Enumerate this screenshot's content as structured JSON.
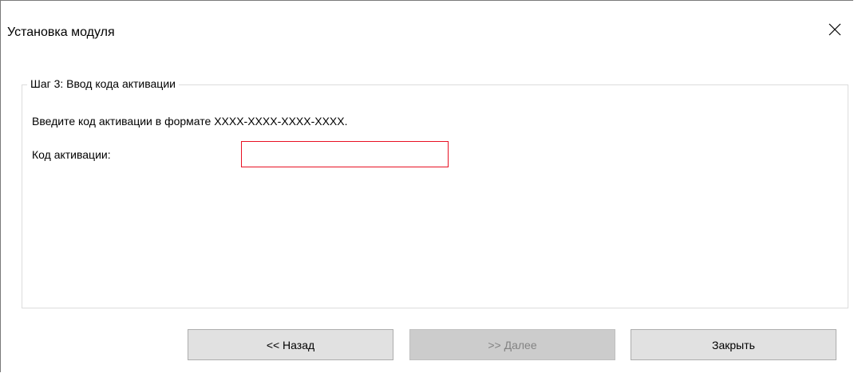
{
  "window": {
    "title": "Установка модуля",
    "close_icon": "close-icon"
  },
  "step": {
    "legend": "Шаг 3: Ввод кода активации",
    "instruction": "Введите код активации в формате XXXX-XXXX-XXXX-XXXX.",
    "code_label": "Код активации:",
    "code_value": "",
    "code_placeholder": "",
    "code_state_color": "#e81123"
  },
  "buttons": {
    "back_label": "<< Назад",
    "next_label": ">> Далее",
    "next_enabled": false,
    "close_label": "Закрыть"
  },
  "colors": {
    "window_bg": "#ffffff",
    "button_bg": "#e1e1e1",
    "button_disabled_bg": "#cccccc",
    "button_disabled_text": "#838383"
  }
}
